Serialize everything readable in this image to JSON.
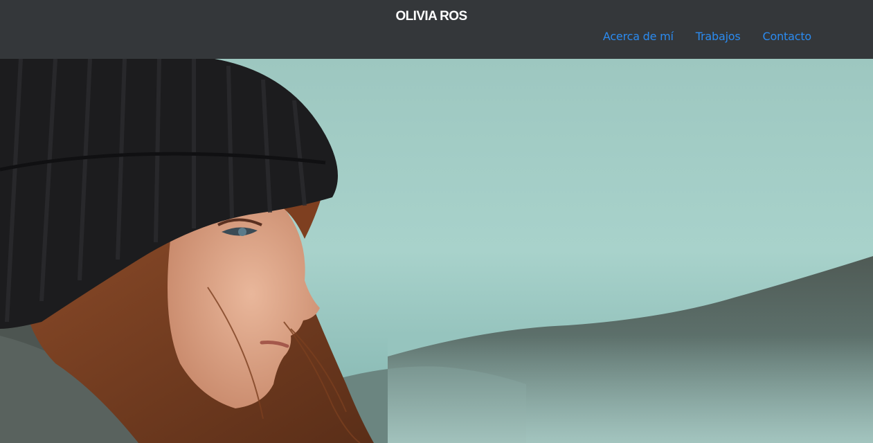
{
  "brand": {
    "name": "OLIVIA ROS"
  },
  "nav": {
    "items": [
      {
        "label": "Acerca de mí"
      },
      {
        "label": "Trabajos"
      },
      {
        "label": "Contacto"
      }
    ]
  },
  "colors": {
    "header_bg": "#34373a",
    "brand_text": "#ffffff",
    "nav_link": "#2b8bf0",
    "sky": "#9cc8c1"
  },
  "hero": {
    "image_subject": "portrait-woman-beanie"
  }
}
